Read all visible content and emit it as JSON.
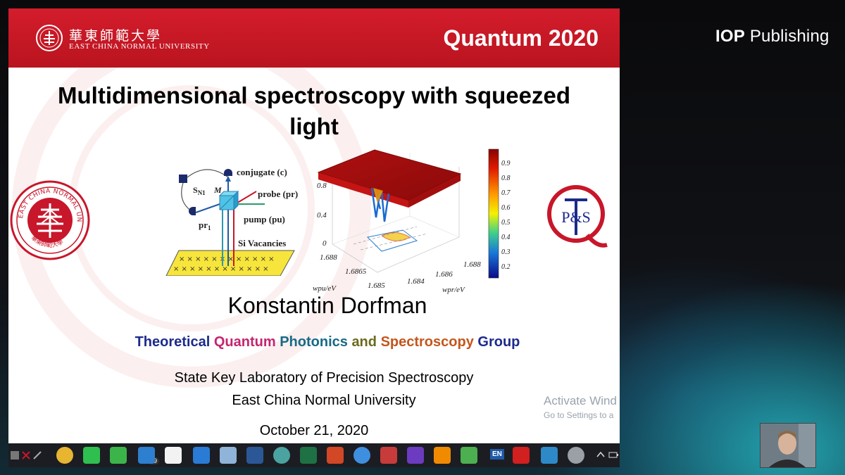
{
  "window": {
    "publisher_logo_bold": "IOP",
    "publisher_logo_rest": " Publishing"
  },
  "slide": {
    "header": {
      "university_cn": "華東師範大學",
      "university_en": "EAST CHINA NORMAL UNIVERSITY",
      "conference": "Quantum 2020"
    },
    "title_line1": "Multidimensional spectroscopy with squeezed",
    "title_line2": "light",
    "seal_text": "EAST CHINA NORMAL UNIVERSITY",
    "seal_cn": "華東師範大學",
    "logo_pts": "P&S",
    "diagram": {
      "conjugate": "conjugate (c)",
      "sn1": "S",
      "sn1_sub": "N1",
      "m": "M",
      "probe": "probe (pr)",
      "pump": "pump (pu)",
      "pr1": "pr",
      "pr1_sub": "1",
      "si": "Si Vacancies"
    },
    "plot": {
      "z_ticks": [
        "0.8",
        "0.4",
        "0"
      ],
      "wpu_ticks": [
        "1.688",
        "1.6865",
        "1.685"
      ],
      "wpr_ticks": [
        "1.684",
        "1.686",
        "1.688"
      ],
      "xlabel": "wpu/eV",
      "ylabel": "wpr/eV",
      "colorbar_ticks": [
        "0.9",
        "0.8",
        "0.7",
        "0.6",
        "0.5",
        "0.4",
        "0.3",
        "0.2"
      ]
    },
    "author": "Konstantin Dorfman",
    "group_words": [
      {
        "text": "Theoretical ",
        "color": "#1d2a8c"
      },
      {
        "text": "Quantum ",
        "color": "#c4256e"
      },
      {
        "text": "Photonics ",
        "color": "#176a86"
      },
      {
        "text": "and ",
        "color": "#6b6a1c"
      },
      {
        "text": "Spectroscopy ",
        "color": "#c4561c"
      },
      {
        "text": "Group",
        "color": "#1d2a8c"
      }
    ],
    "lab_line1": "State Key Laboratory of Precision Spectroscopy",
    "lab_line2": "East China Normal University",
    "date": "October 21, 2020",
    "activate_title": "Activate Wind",
    "activate_sub": "Go to Settings to a"
  },
  "taskbar": {
    "mail_badge": "79",
    "language": "EN",
    "icons": [
      {
        "name": "chrome-icon",
        "color": "#e8b531"
      },
      {
        "name": "whatsapp-icon",
        "color": "#2fbf4f"
      },
      {
        "name": "wechat-icon",
        "color": "#3bb54a"
      },
      {
        "name": "mail-icon",
        "color": "#2d7fd0"
      },
      {
        "name": "store-icon",
        "color": "#f2f2f2"
      },
      {
        "name": "photos-icon",
        "color": "#2a7bd6"
      },
      {
        "name": "printer-icon",
        "color": "#8fb3d9"
      },
      {
        "name": "word-icon",
        "color": "#2b5797"
      },
      {
        "name": "globe-icon",
        "color": "#4aa3a1"
      },
      {
        "name": "excel-icon",
        "color": "#1d7144"
      },
      {
        "name": "powerpoint-icon",
        "color": "#d24726"
      },
      {
        "name": "browser-icon",
        "color": "#3f8fe0"
      },
      {
        "name": "settings-gear-icon",
        "color": "#c73b3b"
      },
      {
        "name": "screen-tool-icon",
        "color": "#6c3bbf"
      },
      {
        "name": "vlc-icon",
        "color": "#f08a00"
      },
      {
        "name": "send-icon",
        "color": "#4caf50"
      },
      {
        "name": "pdf-icon",
        "color": "#d21f1f"
      },
      {
        "name": "video-icon",
        "color": "#2d89c8"
      },
      {
        "name": "record-icon",
        "color": "#9aa0a6"
      }
    ]
  }
}
